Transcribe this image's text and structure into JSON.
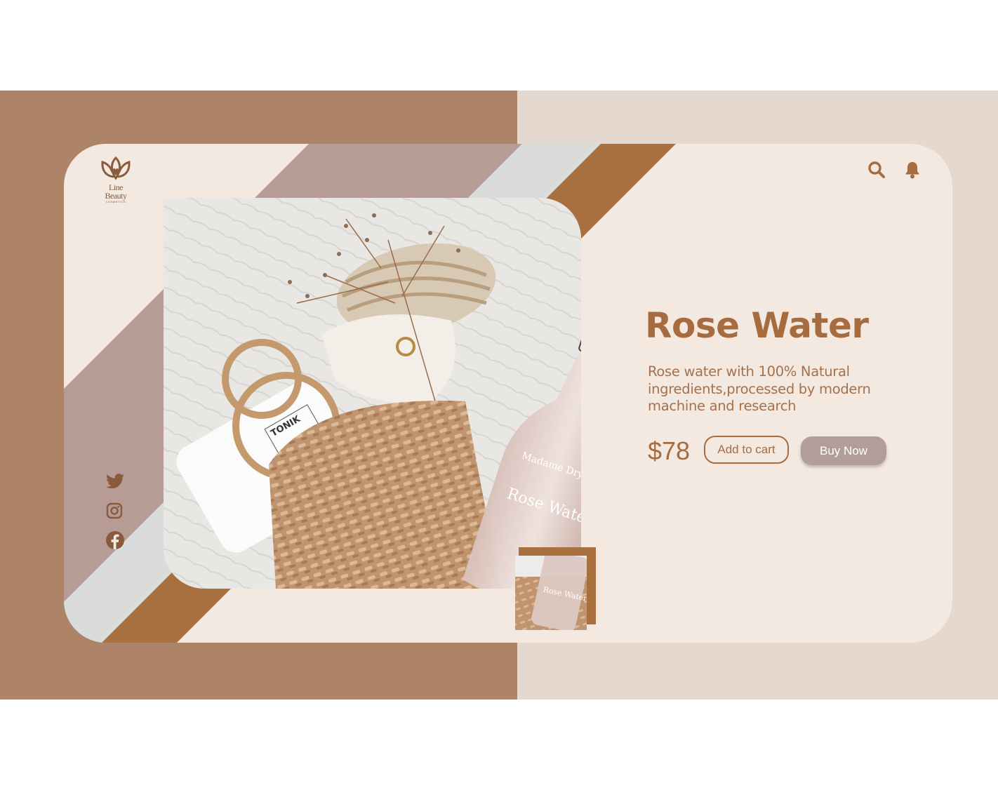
{
  "brand": {
    "name": "Line Beauty",
    "tagline": "COSMETICS",
    "logo_icon": "lotus-heart-icon"
  },
  "header": {
    "icons": [
      "search-icon",
      "bell-icon"
    ]
  },
  "social": {
    "icons": [
      "twitter-icon",
      "instagram-icon",
      "facebook-icon"
    ]
  },
  "product": {
    "title": "Rose Water",
    "description": "Rose water  with 100% Natural ingredients,processed by modern machine and research",
    "price": "$78",
    "image_bottle_label": "Rose Water",
    "image_bottle_brand": "Madame Dry",
    "image_carton_label": "TONIK"
  },
  "actions": {
    "add_to_cart": "Add to cart",
    "buy_now": "Buy Now"
  },
  "colors": {
    "brand_brown": "#a66b3f",
    "left_panel": "#ad8467",
    "right_panel": "#e5d9cf",
    "card": "#f3e9e0",
    "mauve_stripe": "#b69c94",
    "grey_stripe": "#dadbdb",
    "dark_stripe": "#a8703f",
    "buy_button": "#b29e99"
  }
}
